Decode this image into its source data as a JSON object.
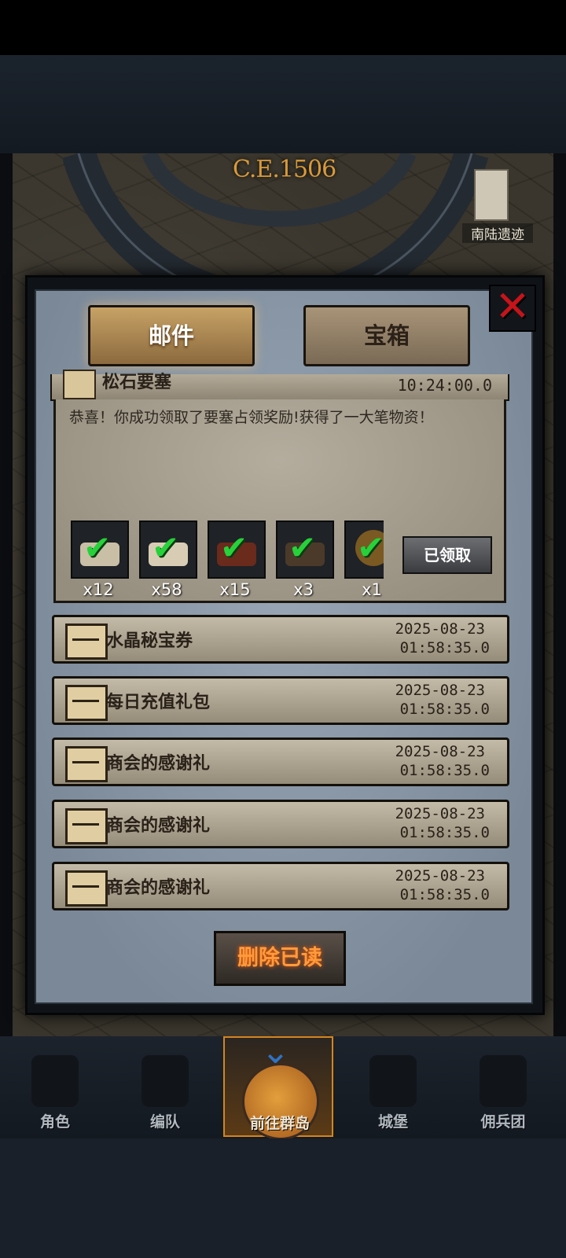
{
  "header": {
    "era": "C.E.1506",
    "location_label": "南陆遗迹"
  },
  "tabs": [
    {
      "label": "邮件",
      "active": true
    },
    {
      "label": "宝箱",
      "active": false
    }
  ],
  "expanded_mail": {
    "title": "松石要塞",
    "time": "10:24:00.0",
    "message": "恭喜！你成功领取了要塞占领奖励!获得了一大笔物资！",
    "rewards": [
      {
        "icon": "hide-icon",
        "qty": "x12"
      },
      {
        "icon": "cloth-icon",
        "qty": "x58"
      },
      {
        "icon": "wood-icon",
        "qty": "x15"
      },
      {
        "icon": "feather-quill-icon",
        "qty": "x3"
      },
      {
        "icon": "emblem-icon",
        "qty": "x1"
      }
    ],
    "claimed_label": "已领取"
  },
  "mails": [
    {
      "title": "水晶秘宝券",
      "date": "2025-08-23",
      "time": "01:58:35.0"
    },
    {
      "title": "每日充值礼包",
      "date": "2025-08-23",
      "time": "01:58:35.0"
    },
    {
      "title": "商会的感谢礼",
      "date": "2025-08-23",
      "time": "01:58:35.0"
    },
    {
      "title": "商会的感谢礼",
      "date": "2025-08-23",
      "time": "01:58:35.0"
    },
    {
      "title": "商会的感谢礼",
      "date": "2025-08-23",
      "time": "01:58:35.0"
    }
  ],
  "delete_read_label": "删除已读",
  "close_symbol": "✕",
  "nav": [
    {
      "label": "角色",
      "icon": "knight-helmet-icon"
    },
    {
      "label": "编队",
      "icon": "formation-icon"
    },
    {
      "label": "前往群岛",
      "icon": "globe-icon",
      "active": true
    },
    {
      "label": "城堡",
      "icon": "castle-icon"
    },
    {
      "label": "佣兵团",
      "icon": "mercenary-banner-icon"
    }
  ],
  "colors": {
    "accent_orange": "#d48520",
    "check_green": "#27d13a",
    "close_red": "#c5141a"
  }
}
